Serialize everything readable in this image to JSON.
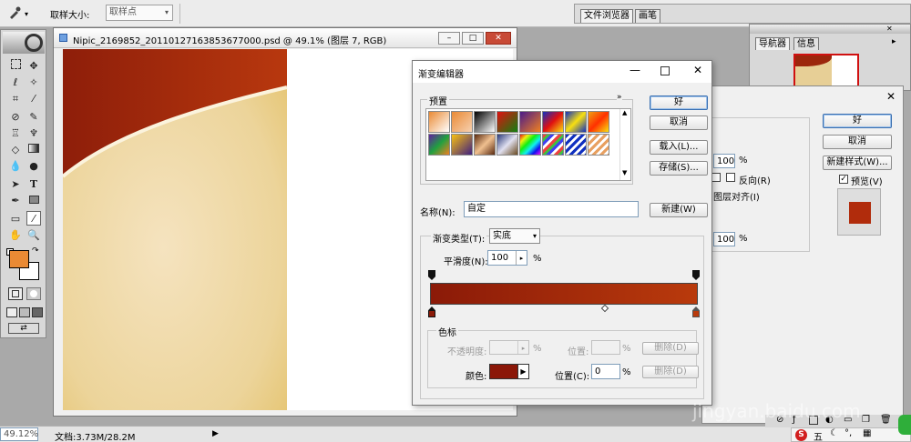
{
  "options_bar": {
    "sample_size_label": "取样大小:",
    "sample_size_value": "取样点"
  },
  "right_tabs": {
    "file_browser": "文件浏览器",
    "brushes": "画笔"
  },
  "navigator": {
    "tab_navigator": "导航器",
    "tab_info": "信息"
  },
  "document": {
    "title": "Nipic_2169852_20110127163853677000.psd @ 49.1% (图层 7, RGB)"
  },
  "gradient_editor": {
    "title": "渐变编辑器",
    "presets_label": "预置",
    "ok": "好",
    "cancel": "取消",
    "load": "载入(L)...",
    "save": "存储(S)...",
    "name_label": "名称(N):",
    "name_value": "自定",
    "new": "新建(W)",
    "gradient_type_label": "渐变类型(T):",
    "gradient_type_value": "实底",
    "smoothness_label": "平滑度(N):",
    "smoothness_value": "100",
    "percent": "%",
    "color_stops_label": "色标",
    "opacity_label": "不透明度:",
    "location_label_top": "位置:",
    "delete_top": "删除(D)",
    "color_label": "颜色:",
    "location_label": "位置(C):",
    "location_value": "0",
    "delete_bottom": "删除(D)",
    "colors": {
      "start": "#8b1a08",
      "end": "#b93a0c",
      "swatch": "#8b1708"
    }
  },
  "layer_style": {
    "ok": "好",
    "cancel": "取消",
    "new_style": "新建样式(W)...",
    "preview": "预览(V)",
    "val1": "100",
    "percent": "%",
    "reverse": "反向(R)",
    "align": "图层对齐(I)",
    "val2": "100",
    "percent2": "%"
  },
  "toolbox": {
    "fg_color": "#ea8a34",
    "bg_color": "#ffffff"
  },
  "status_bar": {
    "zoom": "49.12%",
    "doc_size": "文档:3.73M/28.2M"
  },
  "watermark": {
    "text": "jingyan.baidu.com"
  },
  "ime": {
    "char": "五"
  }
}
